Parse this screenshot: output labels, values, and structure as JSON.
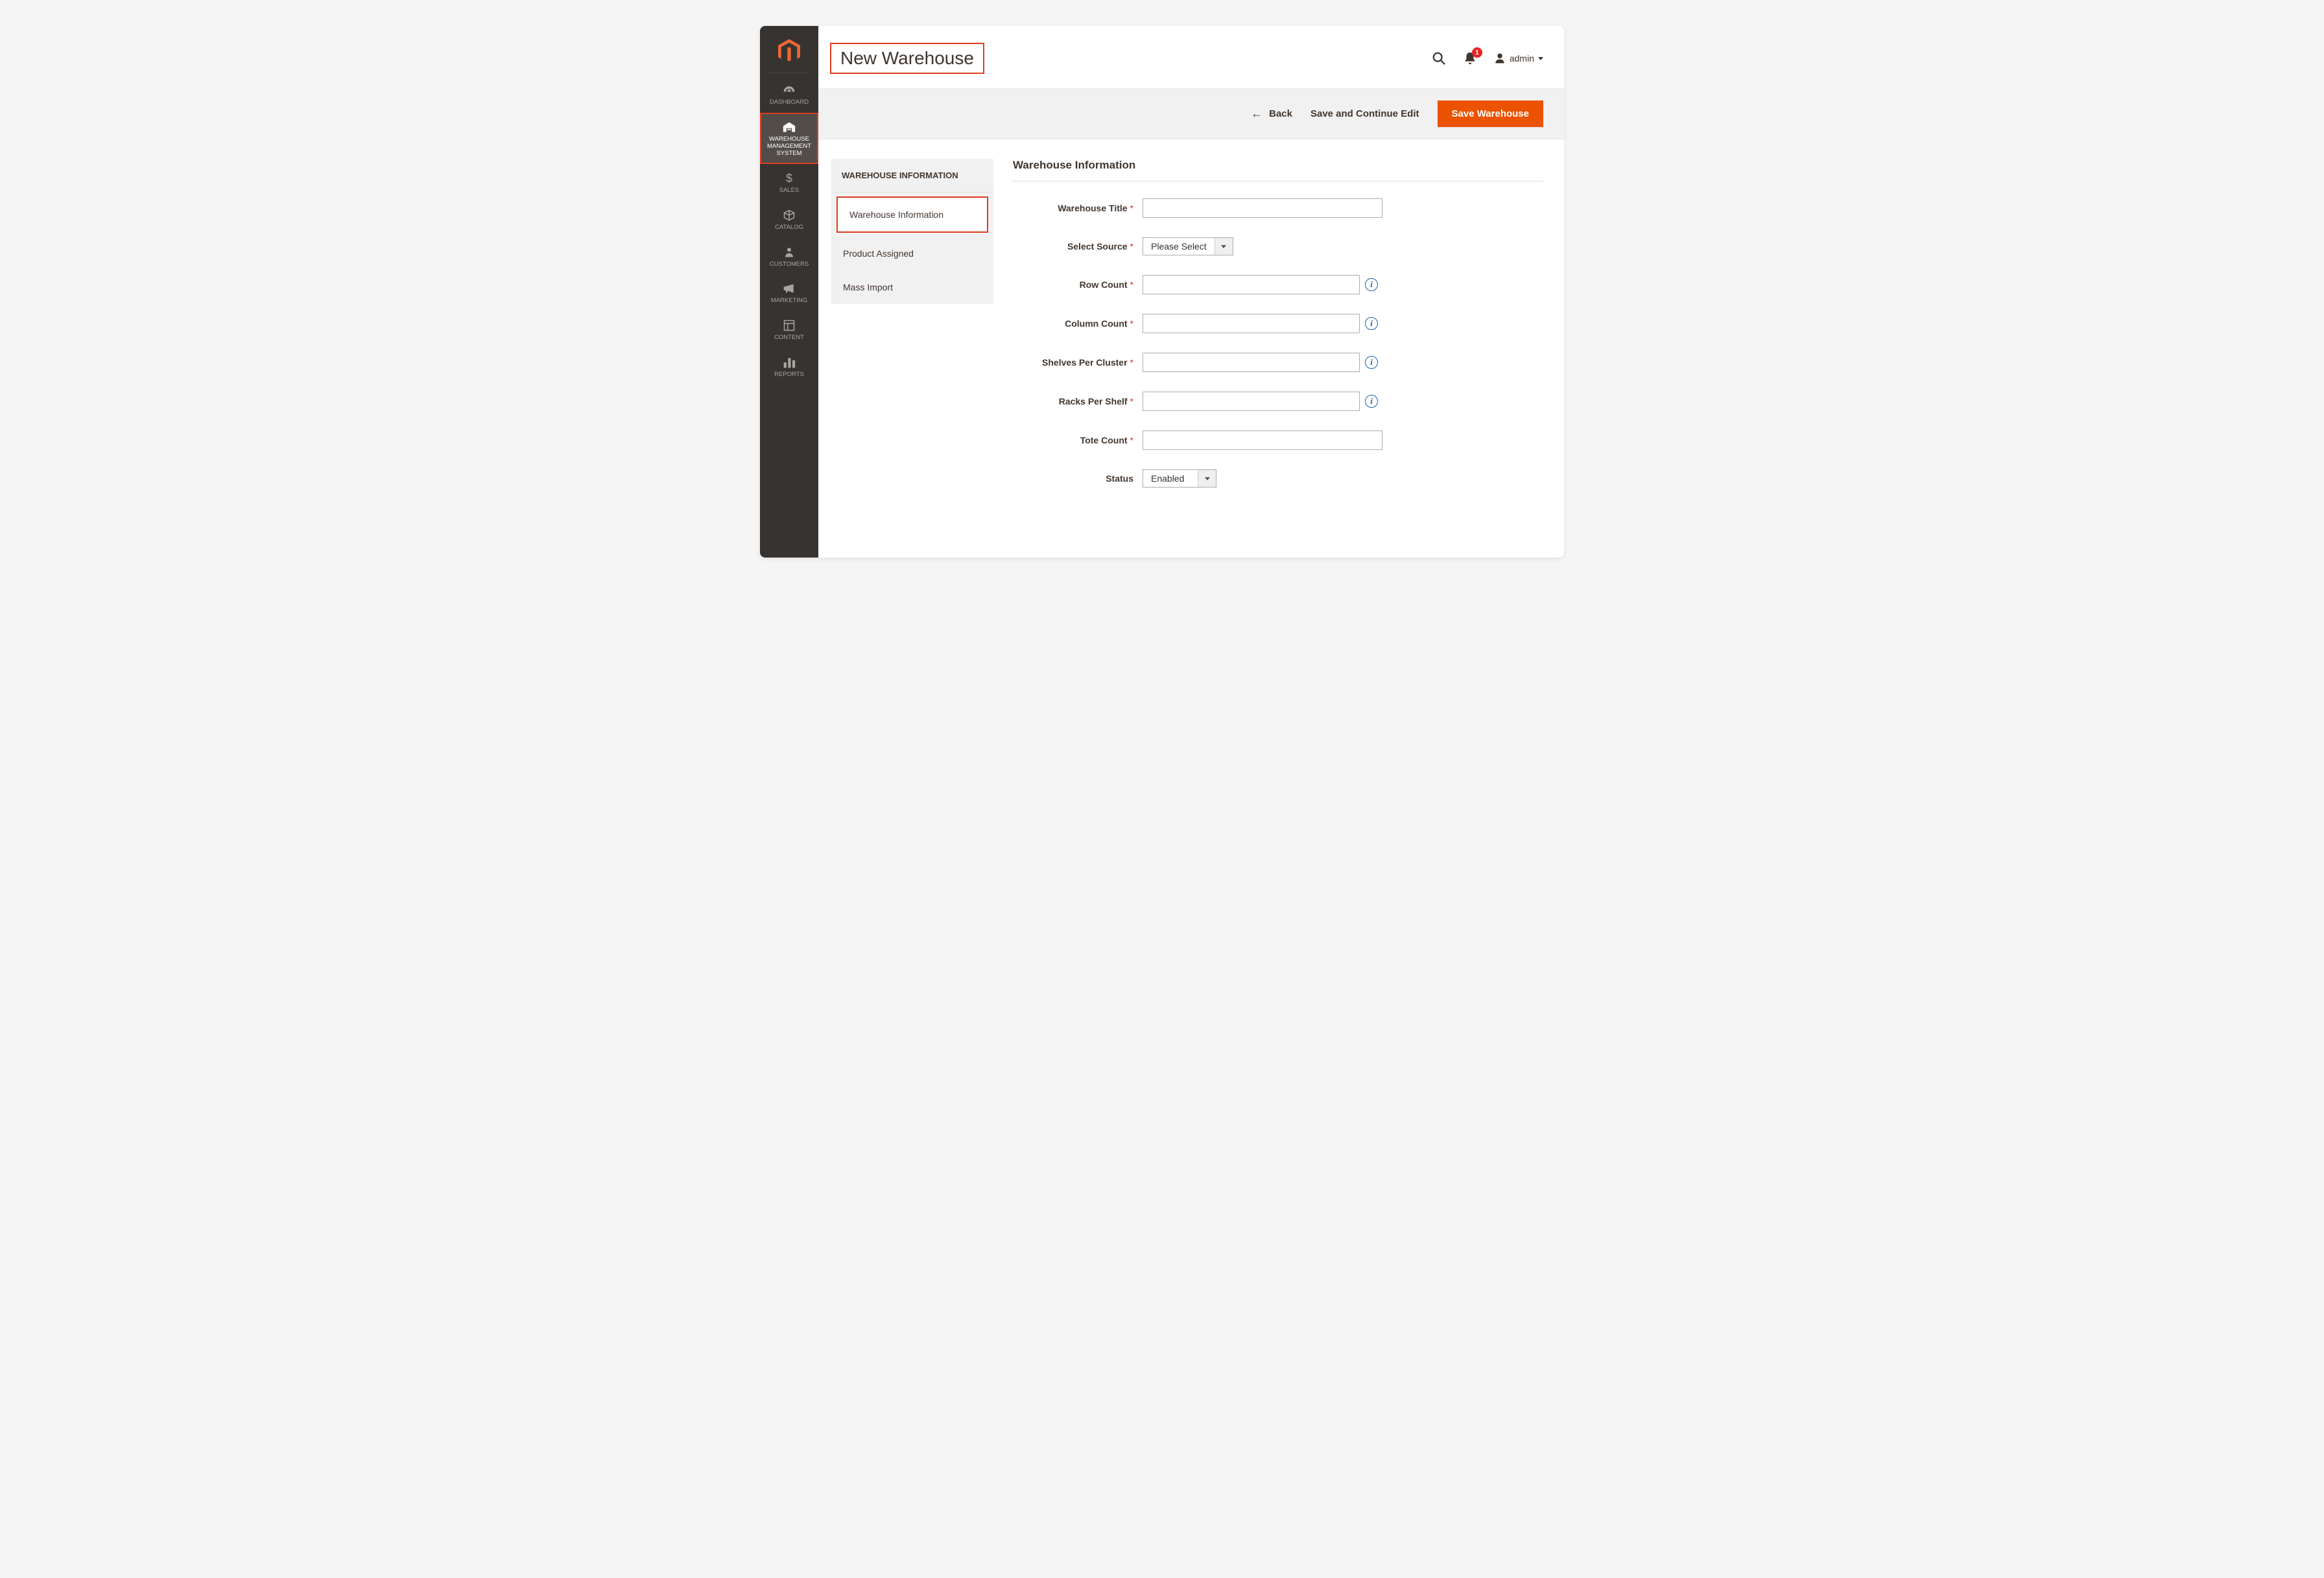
{
  "sidebar": {
    "items": [
      {
        "label": "DASHBOARD"
      },
      {
        "label": "WAREHOUSE MANAGEMENT SYSTEM"
      },
      {
        "label": "SALES"
      },
      {
        "label": "CATALOG"
      },
      {
        "label": "CUSTOMERS"
      },
      {
        "label": "MARKETING"
      },
      {
        "label": "CONTENT"
      },
      {
        "label": "REPORTS"
      }
    ]
  },
  "header": {
    "page_title": "New Warehouse",
    "notification_count": "1",
    "user_label": "admin"
  },
  "action_bar": {
    "back_label": "Back",
    "save_continue_label": "Save and Continue Edit",
    "save_label": "Save Warehouse"
  },
  "side_tabs": {
    "header": "WAREHOUSE INFORMATION",
    "items": [
      {
        "label": "Warehouse Information"
      },
      {
        "label": "Product Assigned"
      },
      {
        "label": "Mass Import"
      }
    ]
  },
  "form": {
    "section_title": "Warehouse Information",
    "fields": {
      "warehouse_title": {
        "label": "Warehouse Title",
        "value": ""
      },
      "select_source": {
        "label": "Select Source",
        "value": "Please Select"
      },
      "row_count": {
        "label": "Row Count",
        "value": ""
      },
      "column_count": {
        "label": "Column Count",
        "value": ""
      },
      "shelves_per_cluster": {
        "label": "Shelves Per Cluster",
        "value": ""
      },
      "racks_per_shelf": {
        "label": "Racks Per Shelf",
        "value": ""
      },
      "tote_count": {
        "label": "Tote Count",
        "value": ""
      },
      "status": {
        "label": "Status",
        "value": "Enabled"
      }
    }
  }
}
